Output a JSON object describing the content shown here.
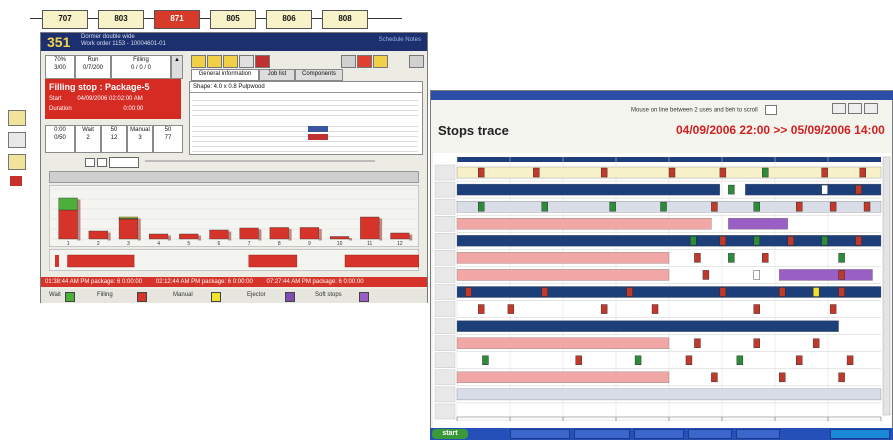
{
  "machine_strip": [
    "707",
    "803",
    "871",
    "805",
    "806",
    "808"
  ],
  "left_window": {
    "machine_number": "351",
    "header_lines": [
      "Dormer double wide",
      "Work order 1153 - 10004601-01"
    ],
    "header_right": "Schedule Notes",
    "stats": [
      {
        "label": "70%",
        "value": "3/00"
      },
      {
        "label": "Run",
        "value": "0/7/200"
      },
      {
        "label": "Filling",
        "value": "0 / 0 / 0"
      }
    ],
    "status_title": "Filling stop : Package-5",
    "status_rows": [
      [
        "Start",
        "04/09/2006 02:02:00 AM"
      ],
      [
        "Duration",
        "0:00:00"
      ]
    ],
    "counters": [
      {
        "label": "0:00",
        "value": "0/50"
      },
      {
        "label": "Wait",
        "value": "2"
      },
      {
        "label": "50",
        "value": "12"
      },
      {
        "label": "Manual",
        "value": "3"
      },
      {
        "label": "50",
        "value": "77"
      }
    ],
    "tabs": [
      "General information",
      "Job list",
      "Components"
    ],
    "info_title": "Shape: 4.0 x 0.8 Pulpwood",
    "legend": [
      {
        "label": "Wait",
        "color": "#4caf3a"
      },
      {
        "label": "Filling",
        "color": "#d6342a"
      },
      {
        "label": "Manual",
        "color": "#f3df2e"
      },
      {
        "label": "Ejector",
        "color": "#7d4cb3"
      },
      {
        "label": "Soft stops",
        "color": "#9a5fc4"
      }
    ],
    "footer_text": [
      "01:38:44 AM PM package: 6   0:00:00",
      "02:12:44 AM PM package: 6   0:00:00",
      "07:27:44 AM PM package: 6   0:00:00"
    ]
  },
  "chart_data": {
    "type": "bar",
    "categories": [
      "1",
      "2",
      "3",
      "4",
      "5",
      "6",
      "7",
      "8",
      "9",
      "10",
      "11",
      "12"
    ],
    "series": [
      {
        "values": [
          58,
          16,
          40,
          10,
          10,
          18,
          22,
          23,
          23,
          5,
          44,
          12
        ]
      },
      {
        "values": [
          24,
          0,
          2,
          0,
          0,
          0,
          0,
          0,
          0,
          0,
          0,
          0
        ]
      },
      {
        "values": [
          0,
          0,
          2,
          0,
          0,
          0,
          0,
          0,
          0,
          0,
          0,
          0
        ]
      }
    ],
    "colors": [
      "#d6342a",
      "#4caf3a",
      "#f3df2e"
    ],
    "ylim": [
      0,
      100
    ]
  },
  "timeline_blocks": [
    {
      "values": [
        0.05,
        0.18,
        0.35
      ]
    },
    {
      "values": [
        0.54,
        0.13
      ]
    },
    {
      "values": [
        0.8,
        0.2
      ]
    }
  ],
  "right_window": {
    "title": "Stops trace",
    "date_range": "04/09/2006 22:00 >> 05/09/2006 14:00",
    "toolbar_text": "Mouse on line between 2 uses and beh to scroll",
    "rows": 15
  },
  "taskbar": {
    "start_label": "start",
    "items": [
      "",
      "",
      "",
      "",
      ""
    ]
  },
  "colors": {
    "navy": "#1c3f7a",
    "red": "#d6342a",
    "pink": "#f2a7a7",
    "green": "#2e8b3a",
    "purple": "#9a5fc4",
    "yellow_grid": "#f7f1c9"
  }
}
